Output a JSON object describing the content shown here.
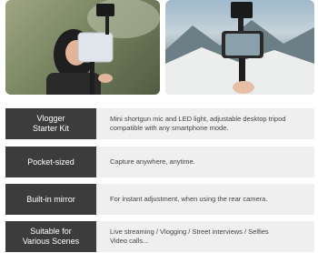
{
  "colors": {
    "label_bg": "#3c3c3c",
    "row_bg": "#efefef",
    "label_text": "#ffffff",
    "desc_text": "#444444"
  },
  "images": [
    {
      "name": "vlogger-holding-phone-photo"
    },
    {
      "name": "phone-on-tripod-mountain-photo"
    }
  ],
  "features": [
    {
      "label": "Vlogger\nStarter Kit",
      "description": "Mini shortgun mic and LED light, adjustable desktop tripod\ncompatible with any smartphone mode."
    },
    {
      "label": "Pocket-sized",
      "description": "Capture anywhere, anytime."
    },
    {
      "label": "Built-in mirror",
      "description": "For instant adjustment, when using the rear camera."
    },
    {
      "label": "Suitable for\nVarious Scenes",
      "description": "Live streaming /  Vlogging / Street interviews / Selfies\nVideo calls..."
    }
  ]
}
